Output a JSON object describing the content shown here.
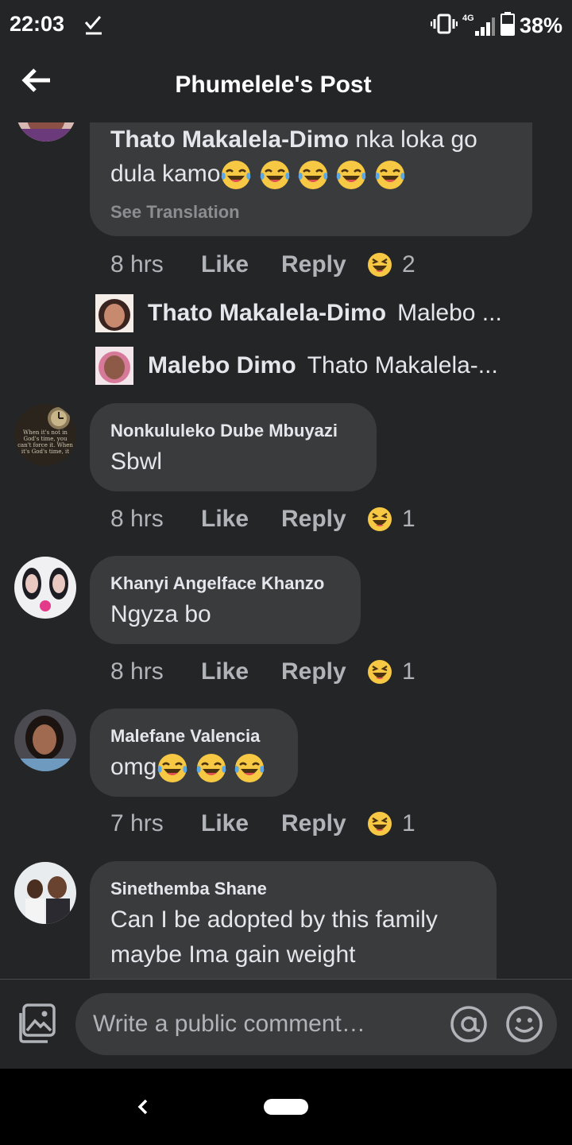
{
  "status_bar": {
    "time": "22:03",
    "network": "4G",
    "battery": "38%"
  },
  "header": {
    "title": "Phumelele's Post"
  },
  "comments": [
    {
      "name": "Thato Makalela-Dimo",
      "text": "nka loka go",
      "text2": "dula kamo",
      "emoji_count": 5,
      "see_translation": "See Translation",
      "time": "8 hrs",
      "like": "Like",
      "reply": "Reply",
      "reactions": "2",
      "replies": [
        {
          "name": "Thato Makalela-Dimo",
          "text": "Malebo ..."
        },
        {
          "name": "Malebo Dimo",
          "text": "Thato Makalela-..."
        }
      ]
    },
    {
      "name": "Nonkululeko Dube Mbuyazi",
      "text": "Sbwl",
      "time": "8 hrs",
      "like": "Like",
      "reply": "Reply",
      "reactions": "1",
      "avatar_text": [
        "When it's not in",
        "God's time, you",
        "can't force it. When",
        "it's God's time, it"
      ]
    },
    {
      "name": "Khanyi Angelface Khanzo",
      "text": "Ngyza bo",
      "time": "8 hrs",
      "like": "Like",
      "reply": "Reply",
      "reactions": "1"
    },
    {
      "name": "Malefane Valencia",
      "text": "omg",
      "emoji_count": 3,
      "time": "7 hrs",
      "like": "Like",
      "reply": "Reply",
      "reactions": "1"
    },
    {
      "name": "Sinethemba Shane",
      "text": "Can I be adopted by this family",
      "text2": "maybe Ima gain weight"
    }
  ],
  "composer": {
    "placeholder": "Write a public comment…"
  },
  "colors": {
    "background": "#242527",
    "bubble": "#3a3b3d",
    "muted": "#b0b3b8",
    "reaction_yellow": "#f7c844"
  }
}
